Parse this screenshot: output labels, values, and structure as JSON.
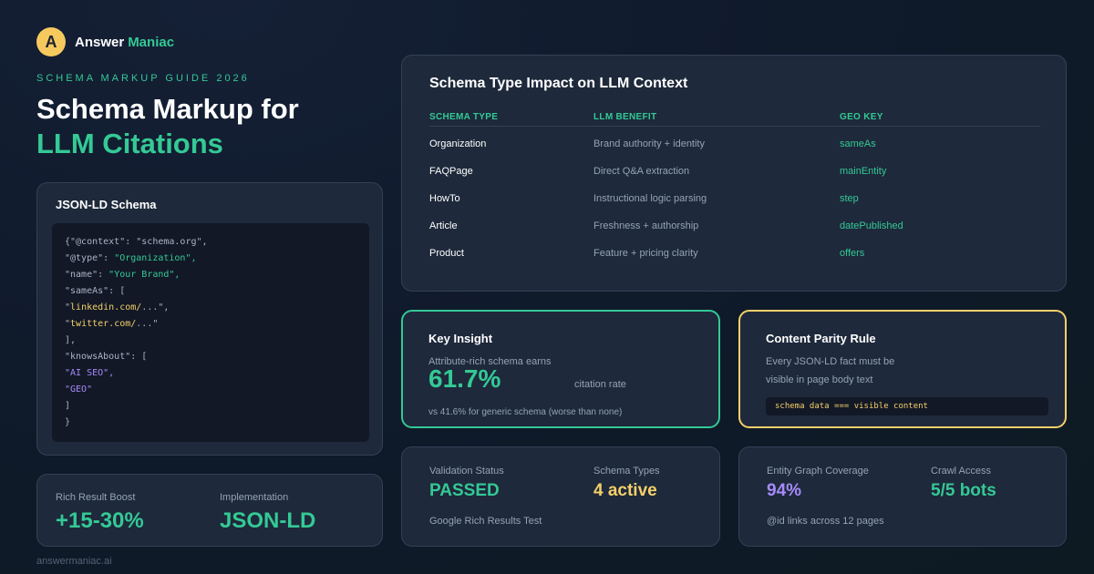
{
  "brand": {
    "logo_letter": "A",
    "name": "Answer",
    "accent": "Maniac"
  },
  "eyebrow": "SCHEMA MARKUP GUIDE 2026",
  "title": {
    "line1": "Schema Markup for",
    "line2": "LLM Citations"
  },
  "json_card": {
    "title": "JSON-LD Schema",
    "code": {
      "l1": "{\"@context\": \"schema.org\",",
      "l2_key": "\"@type\": ",
      "l2_val": "\"Organization\",",
      "l3_key": "\"name\": ",
      "l3_val": "\"Your Brand\",",
      "l4": "\"sameAs\": [",
      "l5_q": "\"",
      "l5_val": "linkedin.com/",
      "l5_rest": "...\",",
      "l6_q": "\"",
      "l6_val": "twitter.com/",
      "l6_rest": "...\"",
      "l7": "],",
      "l8": "\"knowsAbout\": [",
      "l9": "\"AI SEO\",",
      "l10": "\"GEO\"",
      "l11": "]",
      "l12": "}"
    }
  },
  "boost": {
    "label1": "Rich Result Boost",
    "value1": "+15-30%",
    "label2": "Implementation",
    "value2": "JSON-LD"
  },
  "footer": "answermaniac.ai",
  "table": {
    "title": "Schema Type Impact on LLM Context",
    "headers": [
      "SCHEMA TYPE",
      "LLM BENEFIT",
      "GEO KEY"
    ],
    "rows": [
      {
        "type": "Organization",
        "benefit": "Brand authority + identity",
        "key": "sameAs"
      },
      {
        "type": "FAQPage",
        "benefit": "Direct Q&A extraction",
        "key": "mainEntity"
      },
      {
        "type": "HowTo",
        "benefit": "Instructional logic parsing",
        "key": "step"
      },
      {
        "type": "Article",
        "benefit": "Freshness + authorship",
        "key": "datePublished"
      },
      {
        "type": "Product",
        "benefit": "Feature + pricing clarity",
        "key": "offers"
      }
    ]
  },
  "insight": {
    "title": "Key Insight",
    "lead": "Attribute-rich schema earns",
    "value": "61.7%",
    "unit": "citation rate",
    "note": "vs 41.6% for generic schema (worse than none)"
  },
  "parity": {
    "title": "Content Parity Rule",
    "line1": "Every JSON-LD fact must be",
    "line2": "visible in page body text",
    "code": "schema data === visible content"
  },
  "validation": {
    "label1": "Validation Status",
    "value1": "PASSED",
    "label2": "Schema Types",
    "value2": "4 active",
    "note": "Google Rich Results Test"
  },
  "entity": {
    "label1": "Entity Graph Coverage",
    "value1": "94%",
    "label2": "Crawl Access",
    "value2": "5/5 bots",
    "note": "@id links across 12 pages"
  },
  "colors": {
    "accent_green": "#34c995",
    "accent_yellow": "#f5d06a",
    "accent_purple": "#a78bfa",
    "card_bg": "#1e293b",
    "page_bg": "#0f1a2b"
  }
}
